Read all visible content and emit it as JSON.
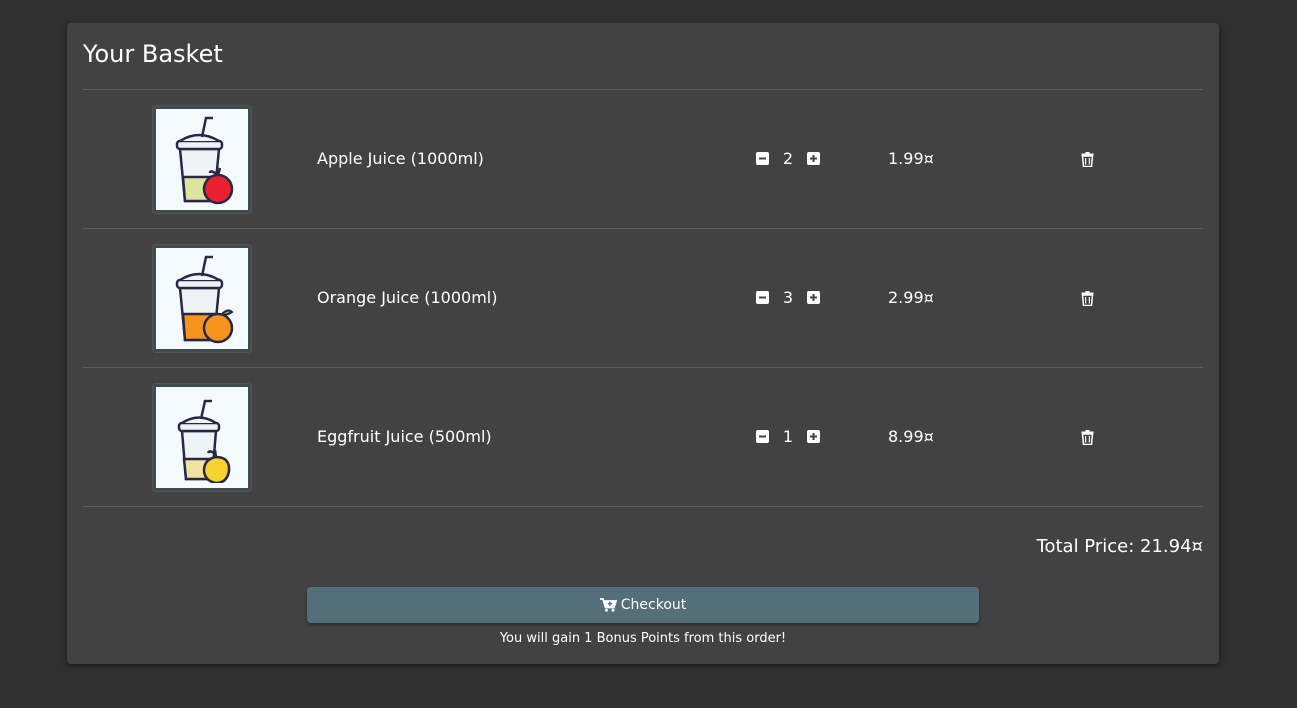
{
  "basket": {
    "title": "Your Basket",
    "items": [
      {
        "name": "Apple Juice (1000ml)",
        "quantity": "2",
        "price": "1.99¤",
        "image_icon": "apple-juice-icon",
        "fruit_color": "#e8202f",
        "liquid_color": "#dce59b"
      },
      {
        "name": "Orange Juice (1000ml)",
        "quantity": "3",
        "price": "2.99¤",
        "image_icon": "orange-juice-icon",
        "fruit_color": "#f7941d",
        "liquid_color": "#f7941d"
      },
      {
        "name": "Eggfruit Juice (500ml)",
        "quantity": "1",
        "price": "8.99¤",
        "image_icon": "eggfruit-juice-icon",
        "fruit_color": "#f7d330",
        "liquid_color": "#f0e3a0"
      }
    ],
    "total_price": "Total Price: 21.94¤",
    "checkout_label": "Checkout",
    "bonus_text": "You will gain 1 Bonus Points from this order!"
  },
  "colors": {
    "background": "#303030",
    "card": "#424242",
    "checkout_button": "#546e7a"
  }
}
